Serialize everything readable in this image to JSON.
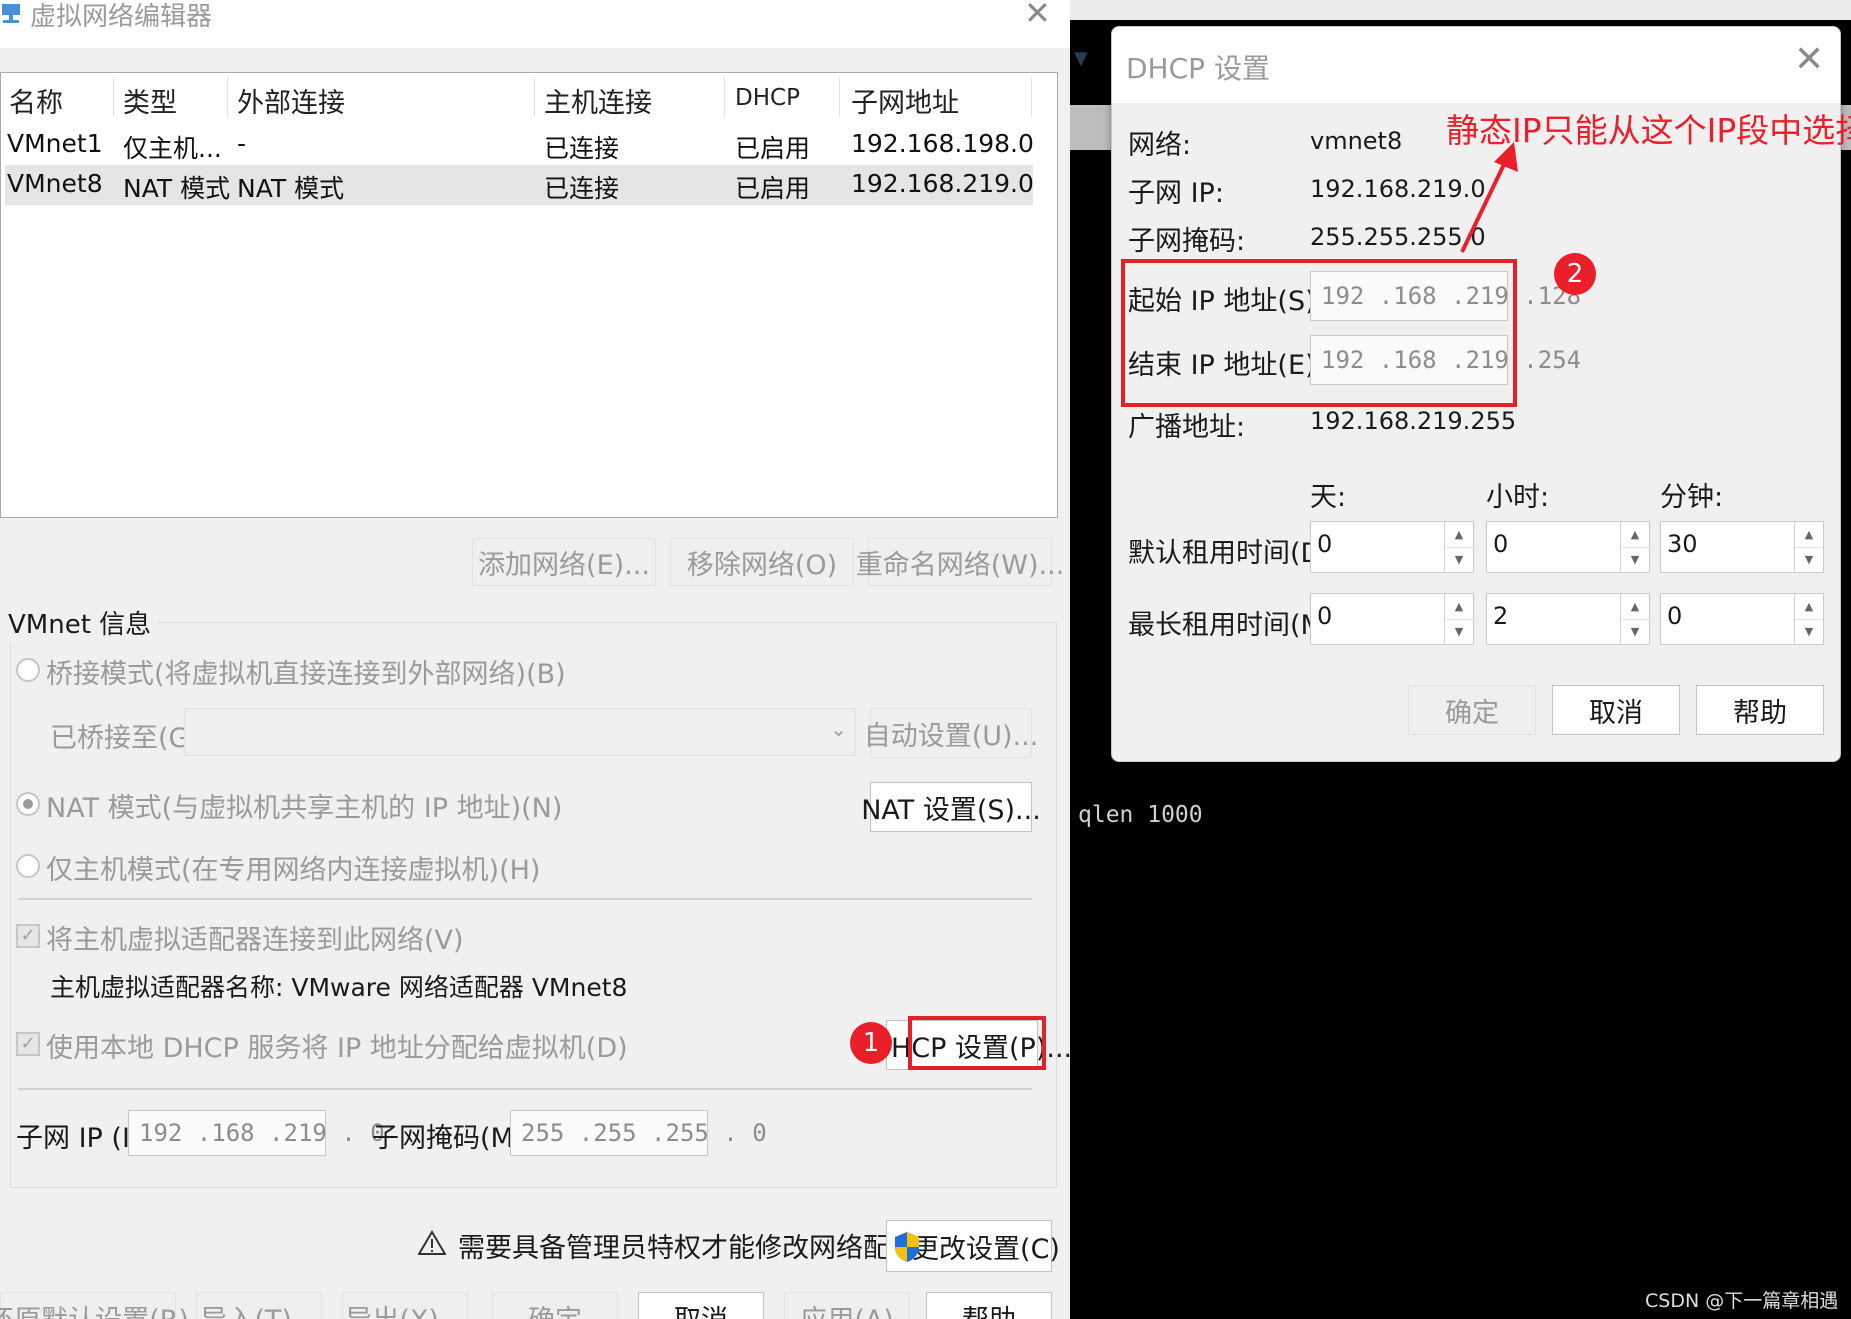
{
  "left_window": {
    "title": "虚拟网络编辑器",
    "close_glyph": "✕",
    "table": {
      "headers": [
        "名称",
        "类型",
        "外部连接",
        "主机连接",
        "DHCP",
        "子网地址"
      ],
      "rows": [
        [
          "VMnet1",
          "仅主机...",
          "-",
          "已连接",
          "已启用",
          "192.168.198.0"
        ],
        [
          "VMnet8",
          "NAT 模式",
          "NAT 模式",
          "已连接",
          "已启用",
          "192.168.219.0"
        ]
      ],
      "selected_row": "VMnet8"
    },
    "buttons": {
      "add_network": "添加网络(E)...",
      "remove_network": "移除网络(O)",
      "rename_network": "重命名网络(W)..."
    },
    "vmnet_info": {
      "group_label": "VMnet 信息",
      "bridge_mode": "桥接模式(将虚拟机直接连接到外部网络)(B)",
      "bridged_to_label": "已桥接至(G):",
      "auto_settings": "自动设置(U)...",
      "nat_mode": "NAT 模式(与虚拟机共享主机的 IP 地址)(N)",
      "nat_settings": "NAT 设置(S)...",
      "host_only_mode": "仅主机模式(在专用网络内连接虚拟机)(H)",
      "connect_adapter": "将主机虚拟适配器连接到此网络(V)",
      "adapter_name": "主机虚拟适配器名称: VMware 网络适配器 VMnet8",
      "use_dhcp": "使用本地 DHCP 服务将 IP 地址分配给虚拟机(D)",
      "dhcp_settings_btn": "HCP 设置(P)...",
      "subnet_ip_label": "子网 IP (I):",
      "subnet_ip_value": "192 .168 .219 . 0",
      "subnet_mask_label": "子网掩码(M):",
      "subnet_mask_value": "255 .255 .255 . 0"
    },
    "admin_notice": "需要具备管理员特权才能修改网络配置。",
    "change_settings": "更改设置(C)",
    "bottom_buttons": [
      "还原默认设置(R)",
      "导入(T)...",
      "导出(X)...",
      "确定",
      "取消",
      "应用(A)",
      "帮助"
    ]
  },
  "terminal": {
    "text": "qlen 1000",
    "arrow_glyph": "▼",
    "watermark": "CSDN @下一篇章相遇"
  },
  "dhcp_dialog": {
    "title": "DHCP 设置",
    "close_glyph": "✕",
    "network_label": "网络:",
    "network_value": "vmnet8",
    "subnet_ip_label": "子网 IP:",
    "subnet_ip_value": "192.168.219.0",
    "subnet_mask_label": "子网掩码:",
    "subnet_mask_value": "255.255.255.0",
    "start_ip_label": "起始 IP 地址(S):",
    "start_ip_value": "192 .168 .219 .128",
    "end_ip_label": "结束 IP 地址(E):",
    "end_ip_value": "192 .168 .219 .254",
    "broadcast_label": "广播地址:",
    "broadcast_value": "192.168.219.255",
    "col_days": "天:",
    "col_hours": "小时:",
    "col_minutes": "分钟:",
    "default_lease_label": "默认租用时间(D):",
    "default_lease": {
      "days": "0",
      "hours": "0",
      "minutes": "30"
    },
    "max_lease_label": "最长租用时间(M):",
    "max_lease": {
      "days": "0",
      "hours": "2",
      "minutes": "0"
    },
    "ok": "确定",
    "cancel": "取消",
    "help": "帮助"
  },
  "annotations": {
    "badge_1": "1",
    "badge_2": "2",
    "note": "静态IP只能从这个IP段中选择一个",
    "color": "#e4202a"
  }
}
